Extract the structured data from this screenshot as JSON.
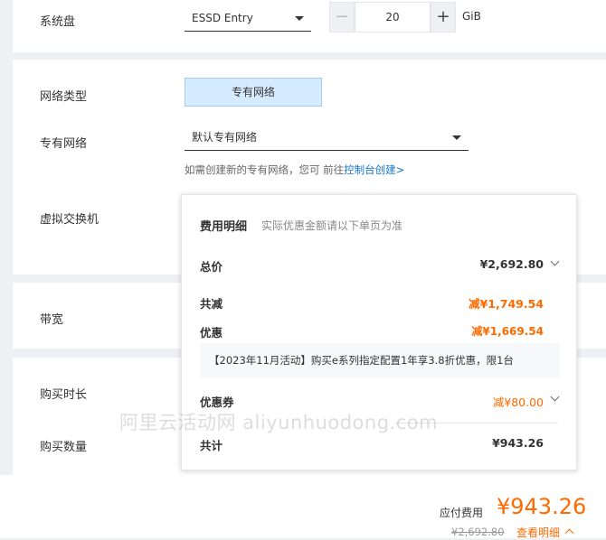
{
  "system_disk": {
    "label": "系统盘",
    "type": "ESSD Entry",
    "size": "20",
    "minus": "−",
    "plus": "+",
    "unit": "GiB"
  },
  "network": {
    "type_label": "网络类型",
    "type_value": "专有网络",
    "vpc_label": "专有网络",
    "vpc_value": "默认专有网络",
    "hint_text": "如需创建新的专有网络，您可 前往",
    "hint_link": "控制台创建>",
    "vswitch_label": "虚拟交换机"
  },
  "bandwidth_label": "带宽",
  "duration_label": "购买时长",
  "quantity_label": "购买数量",
  "cost_popup": {
    "title": "费用明细",
    "subtitle": "实际优惠金额请以下单页为准",
    "total_label": "总价",
    "total_value": "¥2,692.80",
    "reduction_label": "共减",
    "reduction_value": "减¥1,749.54",
    "discount_label": "优惠",
    "discount_value": "减¥1,669.54",
    "promo_text": "【2023年11月活动】购买e系列指定配置1年享3.8折优惠，限1台",
    "coupon_label": "优惠券",
    "coupon_value": "减¥80.00",
    "sum_label": "共计",
    "sum_value": "¥943.26"
  },
  "watermark": "阿里云活动网 aliyunhuodong.com",
  "footer": {
    "payable_label": "应付费用",
    "payable_amount": "¥943.26",
    "original_price": "¥2,692.80",
    "detail_link": "查看明细"
  },
  "colors": {
    "accent_orange": "#ff6a00",
    "link_blue": "#1673d1",
    "selected_bg": "#d6ebff"
  }
}
